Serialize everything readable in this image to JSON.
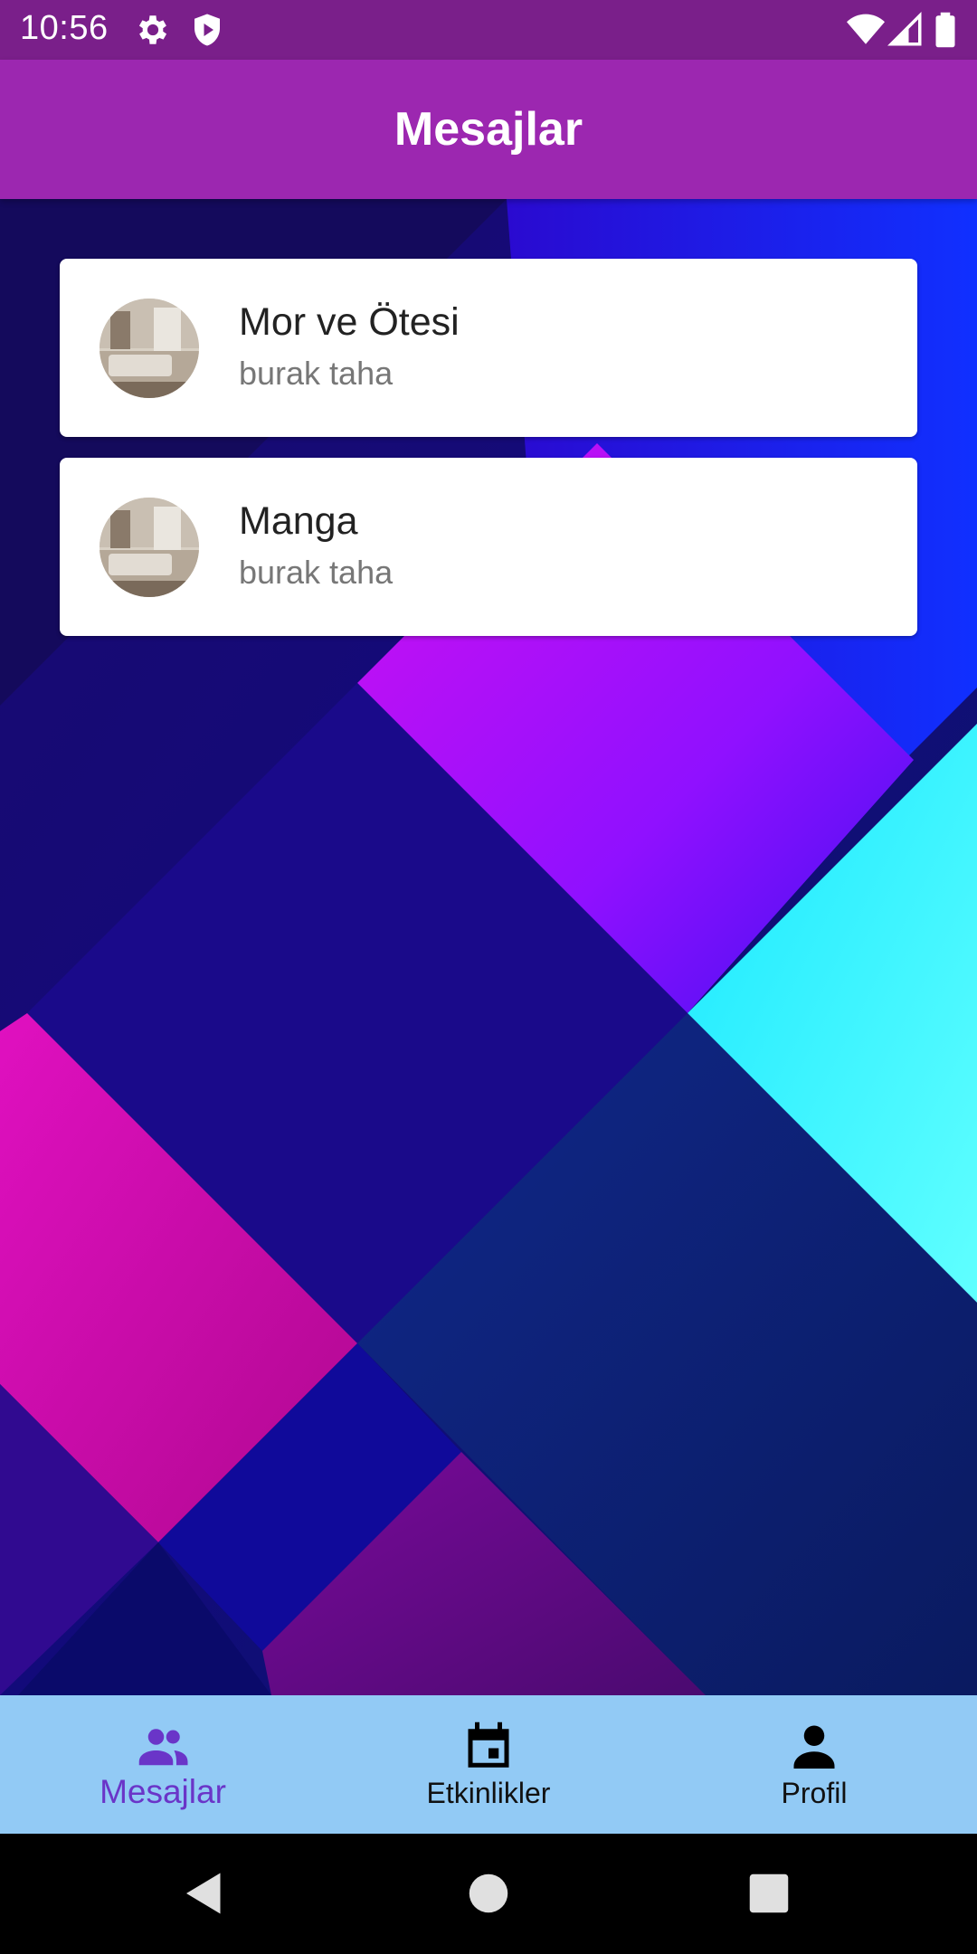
{
  "status_bar": {
    "time": "10:56",
    "left_icons": [
      "gear-icon",
      "shield-play-icon"
    ],
    "right_icons": [
      "wifi-icon",
      "signal-icon",
      "battery-icon"
    ]
  },
  "app_bar": {
    "title": "Mesajlar",
    "color": "#9c27b0"
  },
  "conversations": [
    {
      "title": "Mor ve Ötesi",
      "subtitle": "burak taha"
    },
    {
      "title": "Manga",
      "subtitle": "burak taha"
    }
  ],
  "bottom_nav": {
    "background": "#92caf5",
    "items": [
      {
        "label": "Mesajlar",
        "icon": "group-icon",
        "active": true
      },
      {
        "label": "Etkinlikler",
        "icon": "calendar-icon",
        "active": false
      },
      {
        "label": "Profil",
        "icon": "person-icon",
        "active": false
      }
    ],
    "active_color": "#6a35c8"
  },
  "system_nav": {
    "buttons": [
      "back-icon",
      "home-icon",
      "recents-icon"
    ]
  }
}
